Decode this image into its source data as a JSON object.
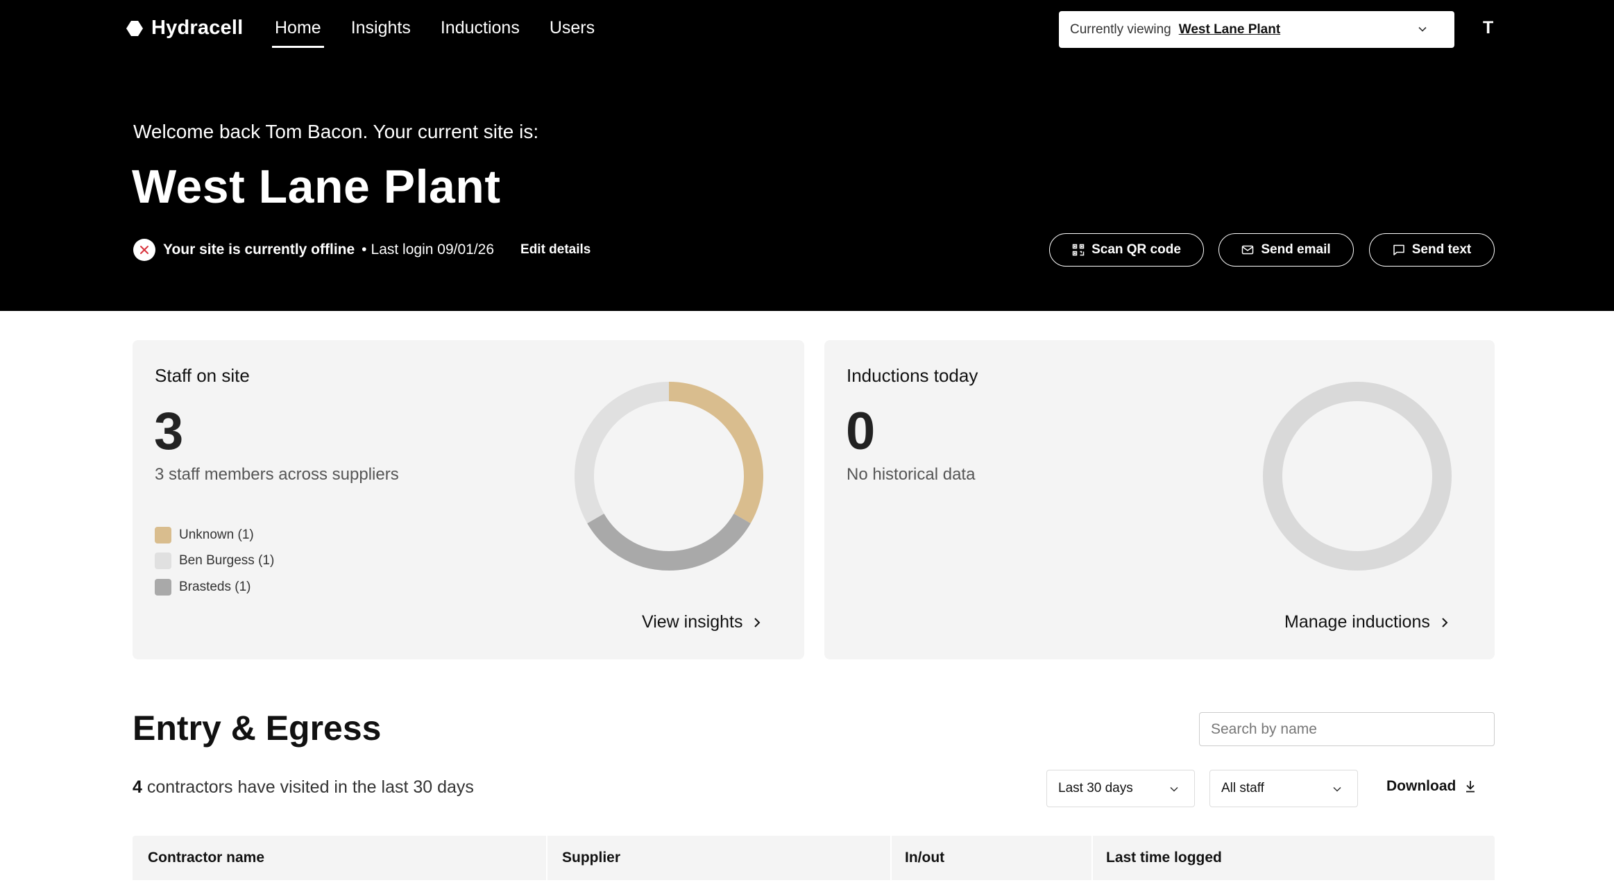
{
  "app": {
    "name": "Hydracell"
  },
  "nav": {
    "items": [
      {
        "label": "Home",
        "active": true
      },
      {
        "label": "Insights",
        "active": false
      },
      {
        "label": "Inductions",
        "active": false
      },
      {
        "label": "Users",
        "active": false
      }
    ]
  },
  "site_selector": {
    "label": "Currently viewing",
    "value": "West Lane Plant",
    "icon": "chevron-down-icon"
  },
  "user": {
    "avatar_initial": "T"
  },
  "hero": {
    "welcome": "Welcome back Tom Bacon. Your current site is:",
    "site_name": "West Lane Plant",
    "status_text": "Your site is currently offline",
    "status_icon": "close-circle-icon",
    "last_login": "Last login 09/01/26",
    "edit_label": "Edit details",
    "actions": [
      {
        "label": "Scan QR code",
        "icon": "qr-code-icon"
      },
      {
        "label": "Send email",
        "icon": "mail-icon"
      },
      {
        "label": "Send text",
        "icon": "message-icon"
      }
    ]
  },
  "staff_card": {
    "title": "Staff on site",
    "count": "3",
    "subtitle": "3 staff members across suppliers",
    "legend": [
      {
        "label": "Unknown (1)",
        "color": "#d9bd8e"
      },
      {
        "label": "Ben Burgess (1)",
        "color": "#e0e0e0"
      },
      {
        "label": "Brasteds (1)",
        "color": "#a9a9a9"
      }
    ],
    "link_label": "View insights"
  },
  "inductions_card": {
    "title": "Inductions today",
    "count": "0",
    "subtitle": "No historical data",
    "empty_color": "#d9d9d9",
    "link_label": "Manage inductions"
  },
  "entry_egress": {
    "title": "Entry & Egress",
    "search_placeholder": "Search by name",
    "count_number": "4",
    "count_text": " contractors have visited in the last 30 days",
    "filter_period": "Last 30 days",
    "filter_staff": "All staff",
    "download_label": "Download",
    "columns": [
      "Contractor name",
      "Supplier",
      "In/out",
      "Last time logged"
    ]
  }
}
